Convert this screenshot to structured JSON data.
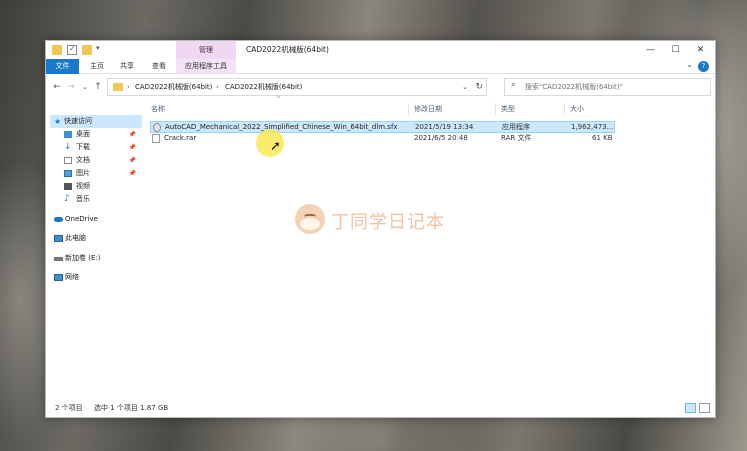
{
  "window": {
    "title": "CAD2022机械版(64bit)",
    "context_tab_group": "管理",
    "controls": {
      "minimize": "—",
      "maximize": "☐",
      "close": "✕"
    }
  },
  "ribbon": {
    "tabs": [
      "文件",
      "主页",
      "共享",
      "查看",
      "应用程序工具"
    ],
    "help": "?",
    "expand": "⌄"
  },
  "address": {
    "back": "←",
    "forward": "→",
    "recent": "⌄",
    "up": "↑",
    "crumbs": [
      "CAD2022机械版(64bit)",
      "CAD2022机械版(64bit)"
    ],
    "sep": "›",
    "dropdown": "⌄",
    "refresh": "↻"
  },
  "search": {
    "placeholder": "搜索\"CAD2022机械版(64bit)\"",
    "icon": "search-icon"
  },
  "nav_pane": {
    "items": [
      {
        "label": "快速访问",
        "icon": "star-icon",
        "selected": true
      },
      {
        "label": "桌面",
        "icon": "desktop-icon",
        "pinned": true
      },
      {
        "label": "下载",
        "icon": "download-icon",
        "pinned": true
      },
      {
        "label": "文档",
        "icon": "document-icon",
        "pinned": true
      },
      {
        "label": "图片",
        "icon": "picture-icon",
        "pinned": true
      },
      {
        "label": "视频",
        "icon": "video-icon"
      },
      {
        "label": "音乐",
        "icon": "music-icon"
      },
      {
        "label": "OneDrive",
        "icon": "cloud-icon"
      },
      {
        "label": "此电脑",
        "icon": "computer-icon"
      },
      {
        "label": "新加卷 (E:)",
        "icon": "drive-icon"
      },
      {
        "label": "网络",
        "icon": "network-icon"
      }
    ],
    "pin_glyph": "📌"
  },
  "file_list": {
    "columns": [
      "名称",
      "修改日期",
      "类型",
      "大小"
    ],
    "sort_caret": "^",
    "rows": [
      {
        "name": "AutoCAD_Mechanical_2022_Simplified_Chinese_Win_64bit_dlm.sfx",
        "date": "2021/5/19 13:34",
        "type": "应用程序",
        "size": "1,962,473...",
        "selected": true
      },
      {
        "name": "Crack.rar",
        "date": "2021/6/5 20:48",
        "type": "RAR 文件",
        "size": "61 KB",
        "selected": false
      }
    ]
  },
  "watermark": {
    "text": "丁同学日记本"
  },
  "status": {
    "count": "2 个项目",
    "selection": "选中 1 个项目  1.87 GB"
  },
  "colors": {
    "accent": "#1979ca",
    "selection_bg": "#cce8ff",
    "tool_tab_bg": "#f0d8f2"
  }
}
